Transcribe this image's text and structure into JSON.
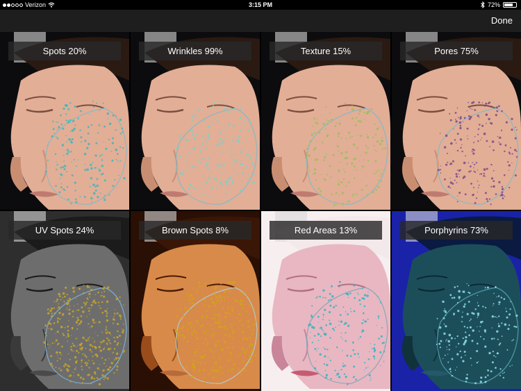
{
  "status_bar": {
    "carrier": "Verizon",
    "time": "3:15 PM",
    "battery": "72%",
    "battery_level": 0.72,
    "signal_bars": 2,
    "icons": [
      "wifi-icon",
      "bluetooth-icon",
      "battery-icon"
    ]
  },
  "nav": {
    "done_label": "Done"
  },
  "tiles": [
    {
      "label": "Spots 20%",
      "style": "natural",
      "spot_color": "#3fb6c0"
    },
    {
      "label": "Wrinkles 99%",
      "style": "natural",
      "spot_color": "#7fd0c8"
    },
    {
      "label": "Texture 15%",
      "style": "natural",
      "spot_color": "#9ac05a"
    },
    {
      "label": "Pores 75%",
      "style": "natural",
      "spot_color": "#7a4a8a"
    },
    {
      "label": "UV Spots 24%",
      "style": "uv",
      "spot_color": "#c9a52a"
    },
    {
      "label": "Brown Spots 8%",
      "style": "brown",
      "spot_color": "#d4a21a"
    },
    {
      "label": "Red Areas 13%",
      "style": "red",
      "spot_color": "#32b5c2"
    },
    {
      "label": "Porphyrins 73%",
      "style": "porphyrin",
      "spot_color": "#8fe3ea"
    }
  ]
}
